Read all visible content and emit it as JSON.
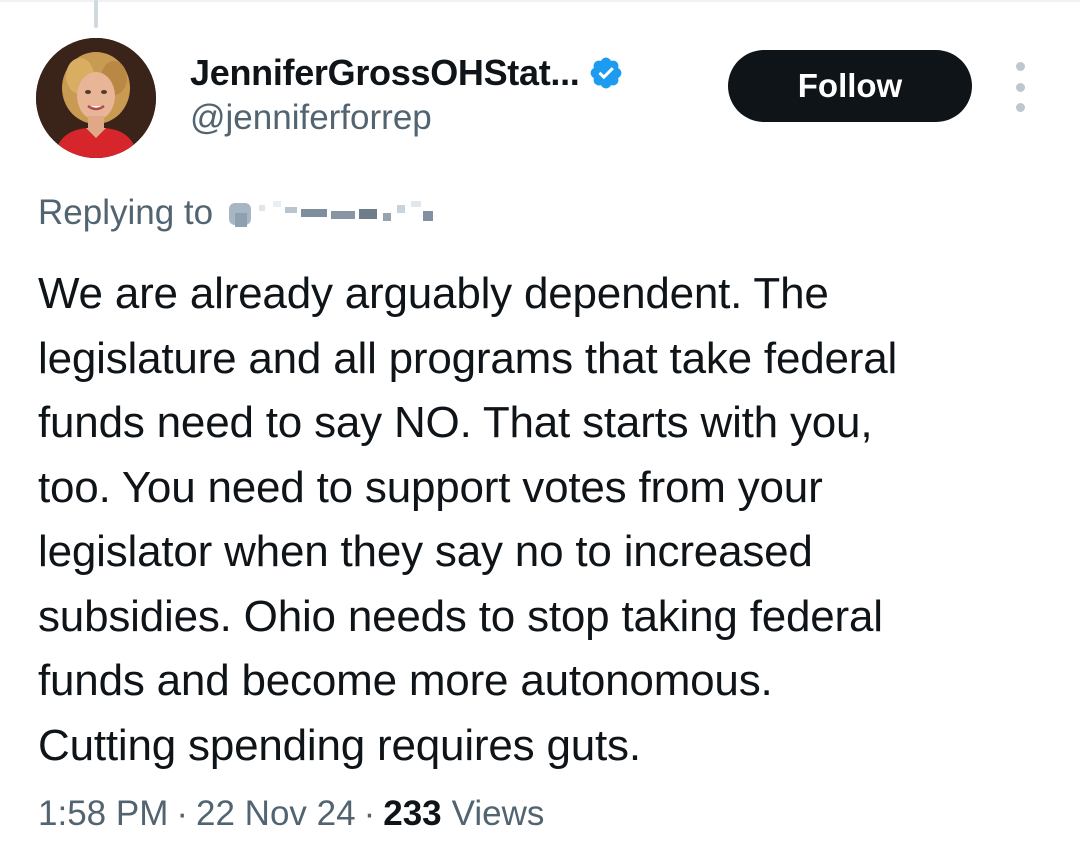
{
  "tweet": {
    "author": {
      "display_name": "JenniferGrossOHStat...",
      "handle": "@jenniferforrep",
      "verified_icon": "verified-badge-icon",
      "verified_color": "#1d9bf0"
    },
    "follow_label": "Follow",
    "more_icon": "more-vertical-icon",
    "replying_to_label": "Replying to",
    "text": "We are already arguably dependent. The\nlegislature and all programs that take federal\nfunds need to say NO. That starts with you,\ntoo. You need to support votes from your\nlegislator when they say no to increased\nsubsidies. Ohio needs to stop taking federal\nfunds and become more autonomous.\nCutting spending requires guts.",
    "time": "1:58 PM",
    "date": "22 Nov 24",
    "separator": "·",
    "views_count": "233",
    "views_label": "Views"
  },
  "colors": {
    "text_primary": "#0f1419",
    "text_secondary": "#536471",
    "follow_bg": "#0f1419",
    "follow_text": "#ffffff"
  }
}
